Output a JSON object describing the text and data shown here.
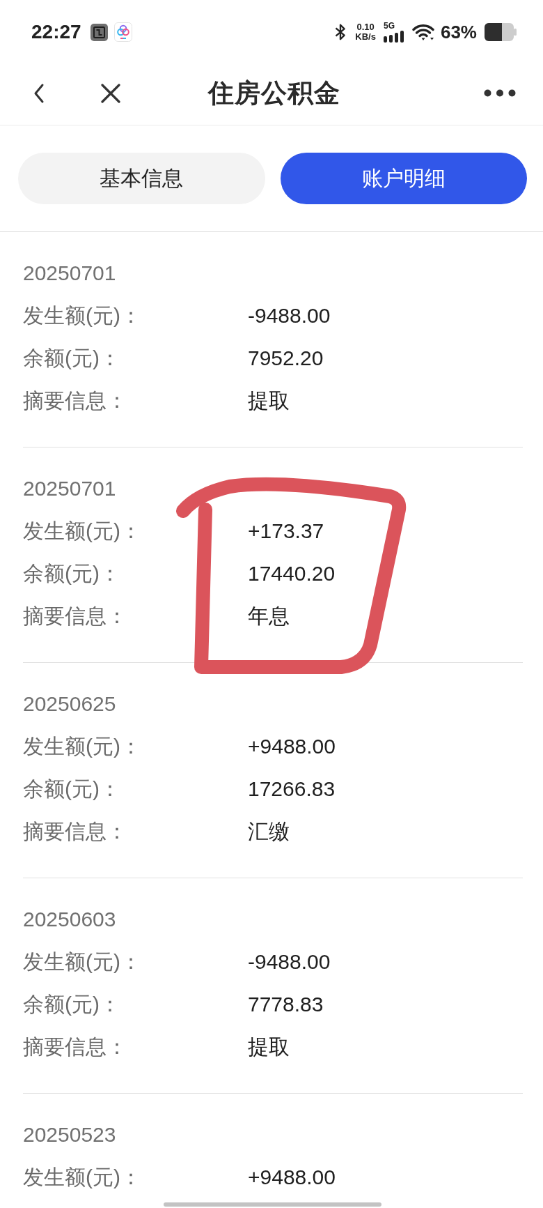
{
  "status_bar": {
    "time": "22:27",
    "speed_value": "0.10",
    "speed_unit": "KB/s",
    "network_type": "5G",
    "battery": "63%"
  },
  "nav": {
    "title": "住房公积金"
  },
  "tabs": [
    {
      "label": "基本信息",
      "selected": false
    },
    {
      "label": "账户明细",
      "selected": true
    }
  ],
  "records": [
    {
      "date": "20250701",
      "circled": false,
      "fields": [
        {
          "label": "发生额(元)：",
          "value": "-9488.00"
        },
        {
          "label": "余额(元)：",
          "value": "7952.20"
        },
        {
          "label": "摘要信息：",
          "value": "提取"
        }
      ]
    },
    {
      "date": "20250701",
      "circled": true,
      "fields": [
        {
          "label": "发生额(元)：",
          "value": "+173.37"
        },
        {
          "label": "余额(元)：",
          "value": "17440.20"
        },
        {
          "label": "摘要信息：",
          "value": "年息"
        }
      ]
    },
    {
      "date": "20250625",
      "circled": false,
      "fields": [
        {
          "label": "发生额(元)：",
          "value": "+9488.00"
        },
        {
          "label": "余额(元)：",
          "value": "17266.83"
        },
        {
          "label": "摘要信息：",
          "value": "汇缴"
        }
      ]
    },
    {
      "date": "20250603",
      "circled": false,
      "fields": [
        {
          "label": "发生额(元)：",
          "value": "-9488.00"
        },
        {
          "label": "余额(元)：",
          "value": "7778.83"
        },
        {
          "label": "摘要信息：",
          "value": "提取"
        }
      ]
    },
    {
      "date": "20250523",
      "circled": false,
      "fields": [
        {
          "label": "发生额(元)：",
          "value": "+9488.00"
        }
      ]
    }
  ]
}
